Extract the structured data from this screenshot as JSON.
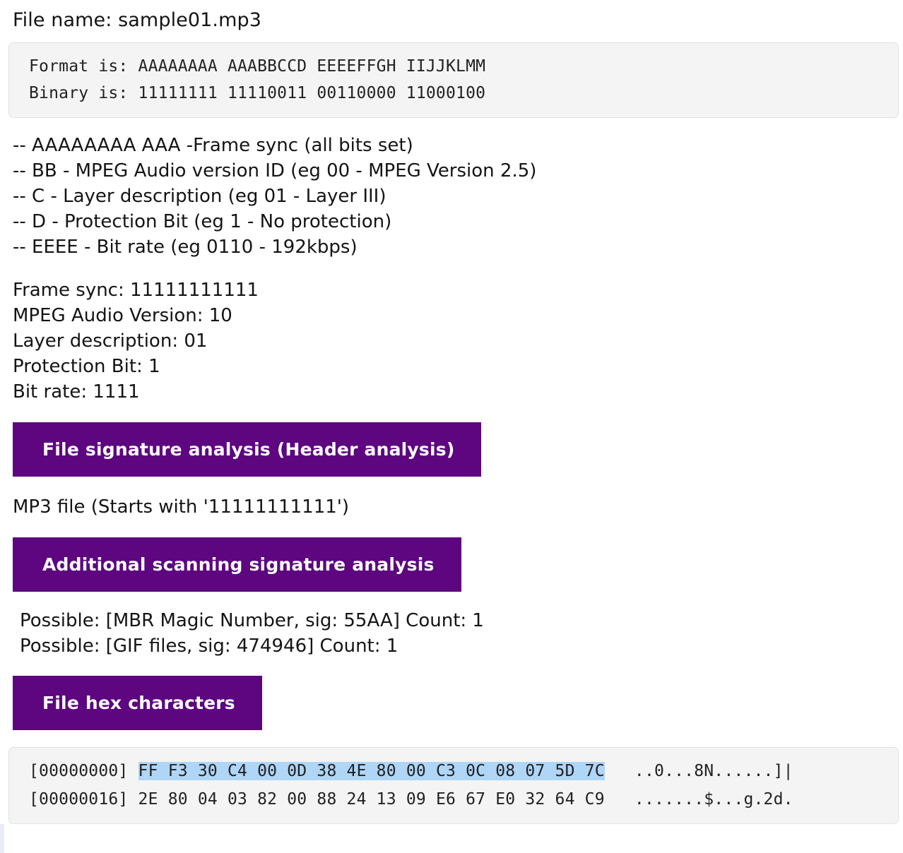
{
  "file": {
    "label": "File name:",
    "name": "sample01.mp3",
    "line": "File name: sample01.mp3"
  },
  "header_code": {
    "format_line": "Format is: AAAAAAAA AAABBCCD EEEEFFGH IIJJKLMM",
    "binary_line": "Binary is: 11111111 11110011 00110000 11000100"
  },
  "spec_lines": [
    "-- AAAAAAAA AAA -Frame sync (all bits set)",
    "-- BB - MPEG Audio version ID (eg 00 - MPEG Version 2.5)",
    "-- C - Layer description (eg 01 - Layer III)",
    "-- D - Protection Bit (eg 1 - No protection)",
    "-- EEEE - Bit rate (eg 0110 - 192kbps)"
  ],
  "fields": [
    "Frame sync: 11111111111",
    "MPEG Audio Version: 10",
    "Layer description: 01",
    "Protection Bit: 1",
    "Bit rate: 1111"
  ],
  "sections": {
    "signature_analysis": "File signature analysis (Header analysis)",
    "additional_scanning": "Additional scanning signature analysis",
    "file_hex": "File hex characters"
  },
  "signature_result": "MP3 file (Starts with '11111111111')",
  "possible_matches": [
    "Possible: [MBR Magic Number, sig: 55AA] Count: 1",
    "Possible: [GIF files, sig: 474946] Count: 1"
  ],
  "hexdump": {
    "rows": [
      {
        "offset": "[00000000]",
        "bytes": "FF F3 30 C4 00 0D 38 4E 80 00 C3 0C 08 07 5D 7C",
        "ascii": "..0...8N......]|",
        "highlighted": true
      },
      {
        "offset": "[00000016]",
        "bytes": "2E 80 04 03 82 00 88 24 13 09 E6 67 E0 32 64 C9",
        "ascii": ".......$...g.2d.",
        "highlighted": false
      }
    ]
  },
  "colors": {
    "section_purple": "#5d0680",
    "hex_highlight": "#afd5f7",
    "code_background": "#f4f4f4",
    "text": "#141414"
  }
}
